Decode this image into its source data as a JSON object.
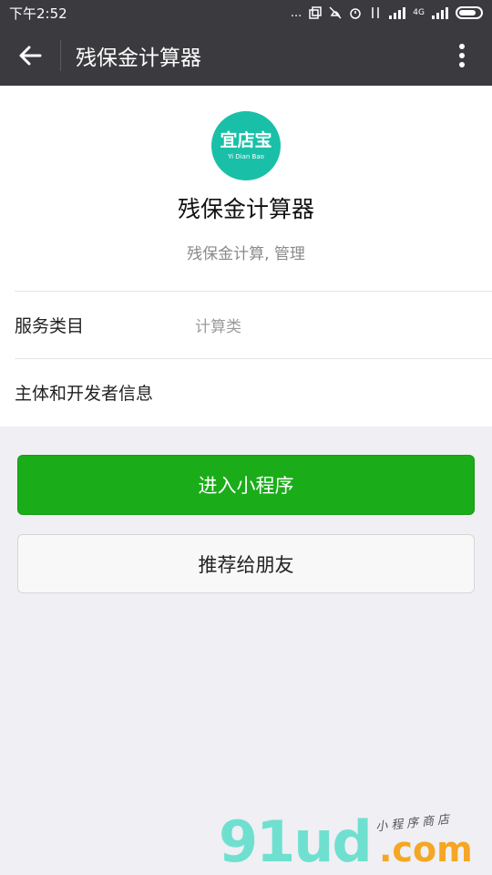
{
  "status_bar": {
    "time": "下午2:52",
    "dots": "...",
    "network_label": "4G",
    "icons": [
      "copy-icon",
      "vibrate-off-icon",
      "alarm-icon",
      "data-arrows-icon",
      "signal-icon",
      "wifi-signal-icon",
      "battery-icon"
    ]
  },
  "header": {
    "title": "残保金计算器",
    "back_icon": "arrow-left-icon",
    "more_icon": "more-vertical-icon"
  },
  "app": {
    "logo_text": "宜店宝",
    "logo_subtext": "Yi Dian Bao",
    "logo_color": "#19c0a7",
    "name": "残保金计算器",
    "description": "残保金计算, 管理"
  },
  "info": {
    "rows": [
      {
        "label": "服务类目",
        "value": "计算类"
      },
      {
        "label": "主体和开发者信息",
        "value": ""
      }
    ]
  },
  "actions": {
    "enter_label": "进入小程序",
    "share_label": "推荐给朋友",
    "primary_color": "#1aad19"
  },
  "watermark": {
    "brand": "91ud",
    "tld": ".com",
    "slogan": "小程序商店"
  }
}
